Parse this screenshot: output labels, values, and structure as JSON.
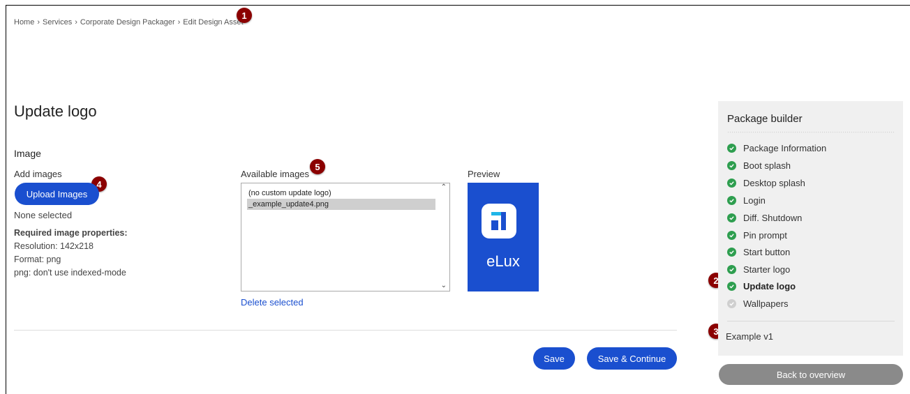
{
  "breadcrumb": {
    "items": [
      "Home",
      "Services",
      "Corporate Design Packager",
      "Edit Design Asset"
    ],
    "separator": "›"
  },
  "markers": [
    "1",
    "2",
    "3",
    "4",
    "5"
  ],
  "page": {
    "title": "Update logo",
    "section_label": "Image",
    "add_images_label": "Add images",
    "upload_button": "Upload Images",
    "none_selected": "None selected",
    "requirements_title": "Required image properties:",
    "requirements": [
      "Resolution: 142x218",
      "Format: png",
      "png: don't use indexed-mode"
    ]
  },
  "available_images": {
    "label": "Available images",
    "options": [
      "(no custom update logo)",
      "_example_update4.png"
    ],
    "selected_index": 1,
    "delete_link": "Delete selected"
  },
  "preview": {
    "label": "Preview",
    "logo_text": "eLux",
    "bg_color": "#1a4fcf",
    "accent_color": "#1fb5e8"
  },
  "actions": {
    "save": "Save",
    "save_continue": "Save & Continue"
  },
  "sidebar": {
    "title": "Package builder",
    "items": [
      {
        "label": "Package Information",
        "status": "done"
      },
      {
        "label": "Boot splash",
        "status": "done"
      },
      {
        "label": "Desktop splash",
        "status": "done"
      },
      {
        "label": "Login",
        "status": "done"
      },
      {
        "label": "Diff. Shutdown",
        "status": "done"
      },
      {
        "label": "Pin prompt",
        "status": "done"
      },
      {
        "label": "Start button",
        "status": "done"
      },
      {
        "label": "Starter logo",
        "status": "done"
      },
      {
        "label": "Update logo",
        "status": "done-active"
      },
      {
        "label": "Wallpapers",
        "status": "pending"
      }
    ],
    "version": "Example v1",
    "back_button": "Back to overview"
  },
  "colors": {
    "primary": "#1a4fcf",
    "success": "#2e9e4f",
    "marker": "#8b0000"
  }
}
